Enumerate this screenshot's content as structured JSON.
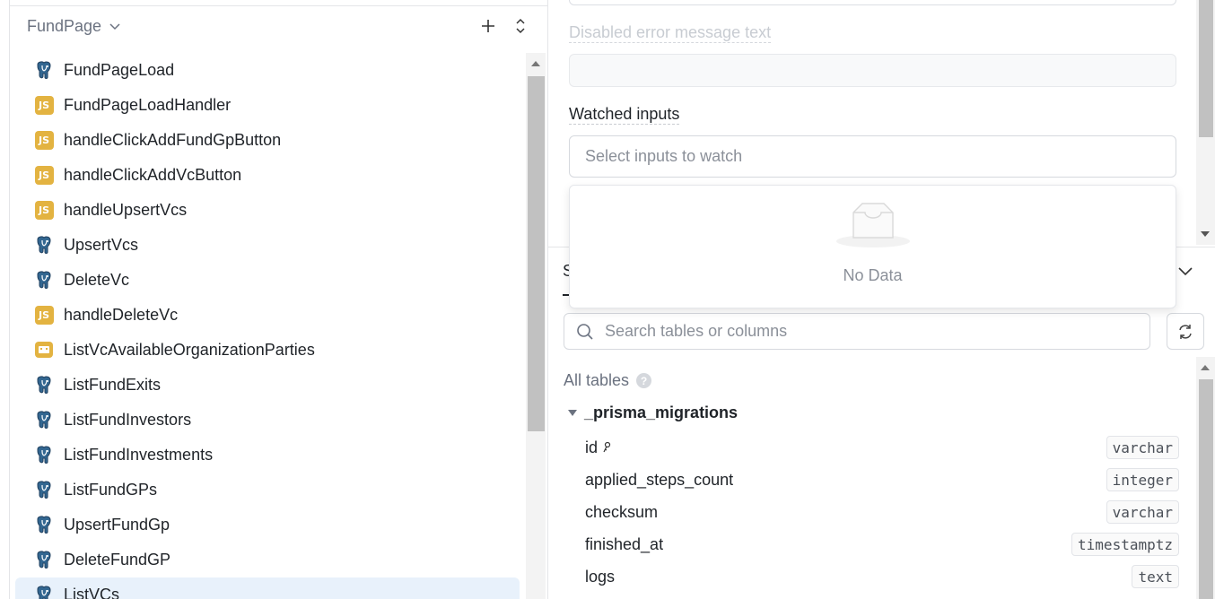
{
  "left": {
    "group_title": "FundPage",
    "items": [
      {
        "label": "FundPageLoad",
        "icon": "postgres-icon"
      },
      {
        "label": "FundPageLoadHandler",
        "icon": "js-icon"
      },
      {
        "label": "handleClickAddFundGpButton",
        "icon": "js-icon"
      },
      {
        "label": "handleClickAddVcButton",
        "icon": "js-icon"
      },
      {
        "label": "handleUpsertVcs",
        "icon": "js-icon"
      },
      {
        "label": "UpsertVcs",
        "icon": "postgres-icon"
      },
      {
        "label": "DeleteVc",
        "icon": "postgres-icon"
      },
      {
        "label": "handleDeleteVc",
        "icon": "js-icon"
      },
      {
        "label": "ListVcAvailableOrganizationParties",
        "icon": "retool-db-icon"
      },
      {
        "label": "ListFundExits",
        "icon": "postgres-icon"
      },
      {
        "label": "ListFundInvestors",
        "icon": "postgres-icon"
      },
      {
        "label": "ListFundInvestments",
        "icon": "postgres-icon"
      },
      {
        "label": "ListFundGPs",
        "icon": "postgres-icon"
      },
      {
        "label": "UpsertFundGp",
        "icon": "postgres-icon"
      },
      {
        "label": "DeleteFundGP",
        "icon": "postgres-icon"
      },
      {
        "label": "ListVCs",
        "icon": "postgres-icon"
      }
    ],
    "selected_index": 15,
    "js_badge": "JS"
  },
  "right": {
    "disabled_label": "Disabled error message text",
    "watched_label": "Watched inputs",
    "watched_placeholder": "Select inputs to watch",
    "dropdown_empty": "No Data",
    "section_initial": "S",
    "search_placeholder": "Search tables or columns",
    "all_tables_label": "All tables",
    "help_glyph": "?",
    "table_name": "_prisma_migrations",
    "columns": [
      {
        "name": "id",
        "type": "varchar",
        "key": true
      },
      {
        "name": "applied_steps_count",
        "type": "integer"
      },
      {
        "name": "checksum",
        "type": "varchar"
      },
      {
        "name": "finished_at",
        "type": "timestamptz"
      },
      {
        "name": "logs",
        "type": "text"
      }
    ]
  },
  "colors": {
    "postgres": "#336791",
    "js": "#e3b341",
    "selected_bg": "#e8f1fb"
  }
}
